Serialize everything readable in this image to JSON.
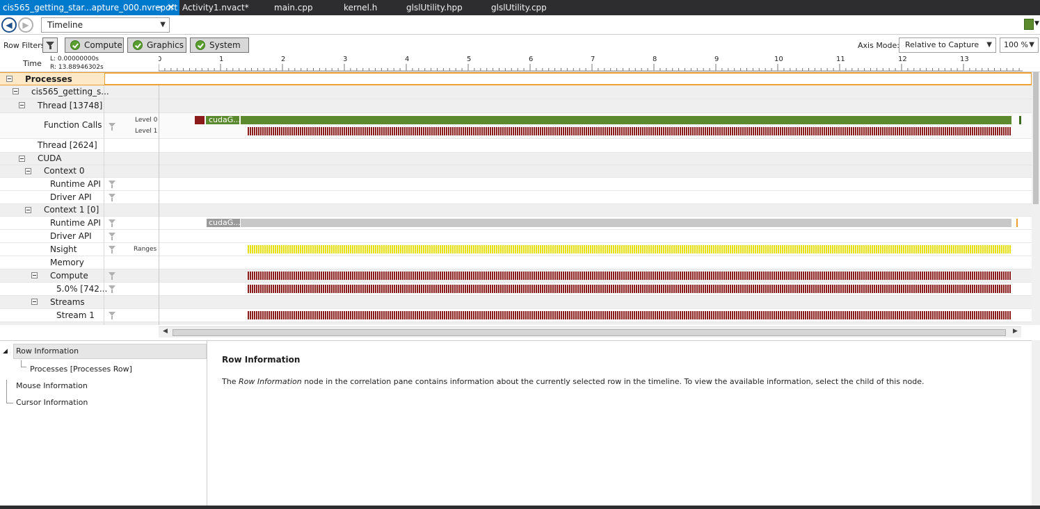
{
  "tabs": [
    {
      "label": "cis565_getting_star...apture_000.nvreport",
      "active": true
    },
    {
      "label": "Activity1.nvact*"
    },
    {
      "label": "main.cpp"
    },
    {
      "label": "kernel.h"
    },
    {
      "label": "glslUtility.hpp"
    },
    {
      "label": "glslUtility.cpp"
    }
  ],
  "toolbar": {
    "view_combo": "Timeline",
    "row_filters_label": "Row Filters",
    "filters": [
      "Compute",
      "Graphics",
      "System"
    ],
    "axis_mode_label": "Axis Mode:",
    "axis_mode_value": "Relative to Capture",
    "zoom_value": "100 %"
  },
  "time_header": {
    "label": "Time",
    "left": "L:  0.00000000s",
    "right": "R:  13.88946302s",
    "ticks": [
      "0",
      "1",
      "2",
      "3",
      "4",
      "5",
      "6",
      "7",
      "8",
      "9",
      "10",
      "11",
      "12",
      "13"
    ]
  },
  "rows": {
    "processes": "Processes",
    "process": "cis565_getting_s...",
    "thread1": "Thread [13748]",
    "function_calls": "Function Calls",
    "level0": "Level 0",
    "level1": "Level 1",
    "fc_bar_text": "cudaG...",
    "thread2": "Thread [2624]",
    "cuda": "CUDA",
    "context0": "Context 0",
    "runtime_api": "Runtime API",
    "driver_api": "Driver API",
    "context1": "Context 1 [0]",
    "rt_bar_text": "cudaG...",
    "nsight": "Nsight",
    "ranges": "Ranges",
    "memory": "Memory",
    "compute": "Compute",
    "compute_pct": "5.0% [742...",
    "streams": "Streams",
    "stream1": "Stream 1"
  },
  "correlation": {
    "tree": {
      "row_info": "Row Information",
      "processes_row": "Processes [Processes Row]",
      "mouse_info": "Mouse Information",
      "cursor_info": "Cursor Information"
    },
    "detail_title": "Row Information",
    "detail_text_pre": "The ",
    "detail_text_em": "Row Information",
    "detail_text_post": " node in the correlation pane contains information about the currently selected row in the timeline. To view the available information, select the child of this node."
  },
  "colors": {
    "accent": "#007acc",
    "kernel_red": "#8b1a1a",
    "call_green": "#5b8a2e",
    "range_yellow": "#e6e010",
    "selection_orange": "#f0a030"
  }
}
